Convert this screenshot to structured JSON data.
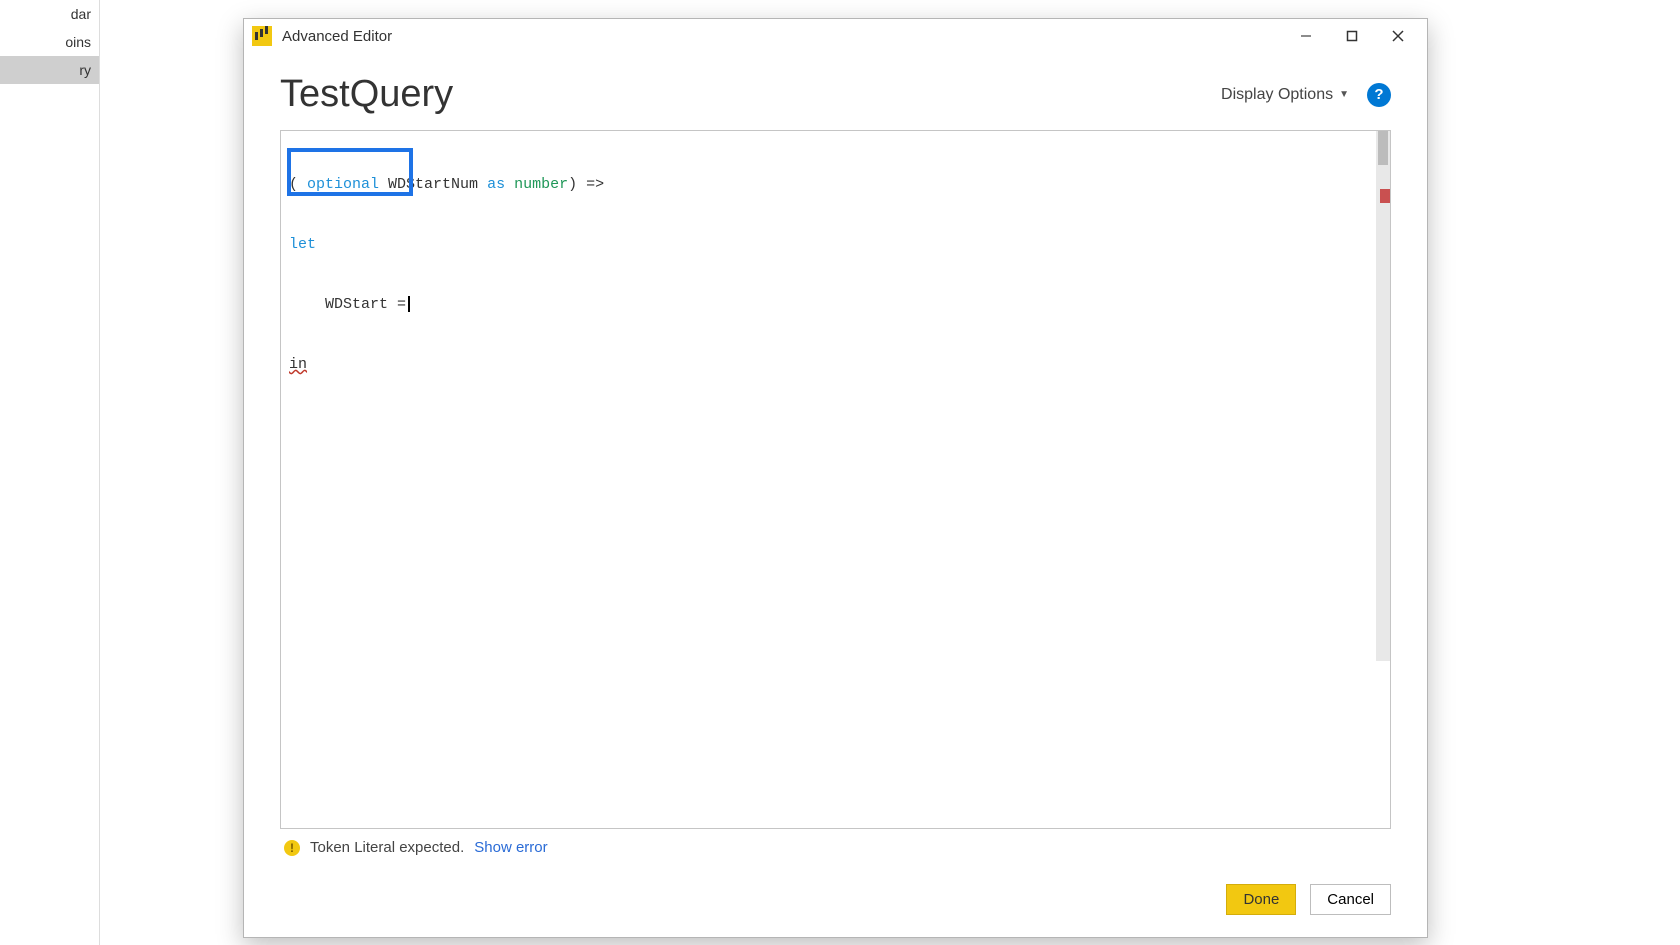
{
  "background_sidebar": {
    "items": [
      {
        "label": "dar",
        "selected": false
      },
      {
        "label": "oins",
        "selected": false
      },
      {
        "label": "ry",
        "selected": true
      }
    ]
  },
  "window": {
    "title": "Advanced Editor",
    "controls": {
      "minimize": "minimize",
      "maximize": "maximize",
      "close": "close"
    }
  },
  "query": {
    "name": "TestQuery"
  },
  "toolbar": {
    "display_options_label": "Display Options",
    "help_tooltip": "Help"
  },
  "code": {
    "line1": {
      "prefix": "( ",
      "kw_optional": "optional",
      "ident": " WDStartNum ",
      "kw_as": "as",
      "space": " ",
      "type": "number",
      "suffix": ") =>"
    },
    "line2": {
      "kw_let": "let"
    },
    "line3": {
      "indent": "    ",
      "ident": "WDStart",
      "op": " ="
    },
    "line4": {
      "underline": "in"
    }
  },
  "status": {
    "message": "Token Literal expected.",
    "show_error_label": "Show error"
  },
  "buttons": {
    "done": "Done",
    "cancel": "Cancel"
  }
}
